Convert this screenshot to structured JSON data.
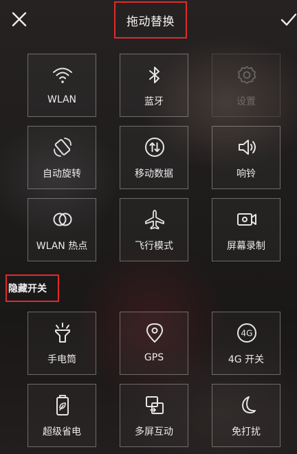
{
  "header": {
    "title": "拖动替换",
    "close_icon": "close-icon",
    "confirm_icon": "check-icon"
  },
  "colors": {
    "highlight_box": "#e02b2b",
    "tile_border": "#d2d2d2",
    "text": "#ececec",
    "disabled_text": "#6e6a69"
  },
  "active_tiles": [
    {
      "label": "WLAN",
      "icon": "wifi-icon",
      "enabled": true
    },
    {
      "label": "蓝牙",
      "icon": "bluetooth-icon",
      "enabled": true
    },
    {
      "label": "设置",
      "icon": "settings-icon",
      "enabled": false
    },
    {
      "label": "自动旋转",
      "icon": "auto-rotate-icon",
      "enabled": true
    },
    {
      "label": "移动数据",
      "icon": "mobile-data-icon",
      "enabled": true
    },
    {
      "label": "响铃",
      "icon": "ring-icon",
      "enabled": true
    },
    {
      "label": "WLAN 热点",
      "icon": "hotspot-icon",
      "enabled": true
    },
    {
      "label": "飞行模式",
      "icon": "airplane-icon",
      "enabled": true
    },
    {
      "label": "屏幕录制",
      "icon": "screen-record-icon",
      "enabled": true
    }
  ],
  "hidden_section": {
    "title": "隐藏开关"
  },
  "hidden_tiles": [
    {
      "label": "手电筒",
      "icon": "flashlight-icon"
    },
    {
      "label": "GPS",
      "icon": "gps-icon"
    },
    {
      "label": "4G 开关",
      "icon": "4g-icon",
      "icon_text": "4G"
    },
    {
      "label": "超级省电",
      "icon": "battery-saver-icon"
    },
    {
      "label": "多屏互动",
      "icon": "multi-screen-icon"
    },
    {
      "label": "免打扰",
      "icon": "do-not-disturb-icon"
    }
  ]
}
